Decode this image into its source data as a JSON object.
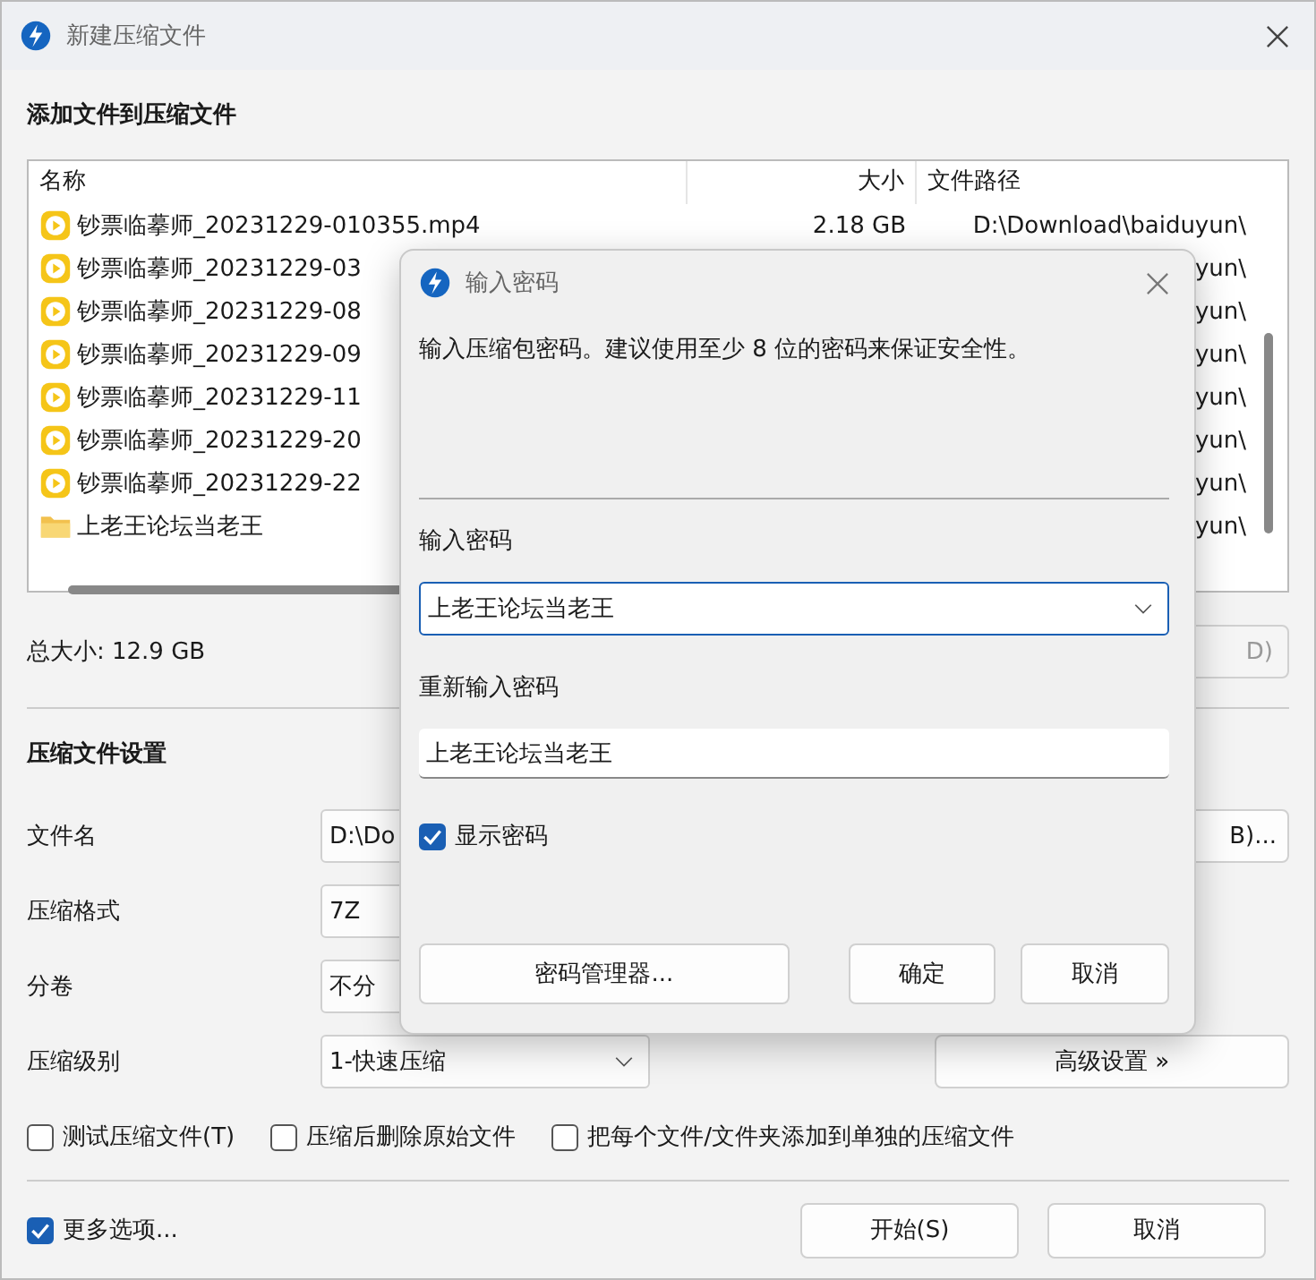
{
  "window": {
    "title": "新建压缩文件"
  },
  "files": {
    "heading": "添加文件到压缩文件",
    "columns": [
      "名称",
      "大小",
      "文件路径"
    ],
    "rows": [
      {
        "kind": "video",
        "name": "钞票临摹师_20231229-010355.mp4",
        "size": "2.18 GB",
        "path": "D:\\Download\\baiduyun\\"
      },
      {
        "kind": "video",
        "name": "钞票临摹师_20231229-03",
        "path": "yun\\"
      },
      {
        "kind": "video",
        "name": "钞票临摹师_20231229-08",
        "path": "yun\\"
      },
      {
        "kind": "video",
        "name": "钞票临摹师_20231229-09",
        "path": "yun\\"
      },
      {
        "kind": "video",
        "name": "钞票临摹师_20231229-11",
        "path": "yun\\"
      },
      {
        "kind": "video",
        "name": "钞票临摹师_20231229-20",
        "path": "yun\\"
      },
      {
        "kind": "video",
        "name": "钞票临摹师_20231229-22",
        "path": "yun\\"
      },
      {
        "kind": "folder",
        "name": "上老王论坛当老王",
        "path": "yun\\"
      }
    ]
  },
  "total_size": "总大小: 12.9 GB",
  "total_button": "D)",
  "settings": {
    "heading": "压缩文件设置",
    "rows": [
      {
        "label": "文件名",
        "kind": "field",
        "value": "D:\\Do",
        "button": "B)..."
      },
      {
        "label": "压缩格式",
        "kind": "field",
        "value": "7Z"
      },
      {
        "label": "分卷",
        "kind": "field",
        "value": "不分"
      },
      {
        "label": "压缩级别",
        "kind": "select",
        "value": "1-快速压缩",
        "button": "高级设置 »"
      }
    ]
  },
  "options": [
    {
      "label": "测试压缩文件(T)",
      "checked": false
    },
    {
      "label": "压缩后删除原始文件",
      "checked": false
    },
    {
      "label": "把每个文件/文件夹添加到单独的压缩文件",
      "checked": false
    }
  ],
  "more_options": {
    "label": "更多选项...",
    "checked": true
  },
  "buttons": [
    "开始(S)",
    "取消"
  ],
  "dialog": {
    "title": "输入密码",
    "message": "输入压缩包密码。建议使用至少 8 位的密码来保证安全性。",
    "password_label": "输入密码",
    "password": "上老王论坛当老王",
    "confirm_label": "重新输入密码",
    "confirm": "上老王论坛当老王",
    "show_password": {
      "label": "显示密码",
      "checked": true
    },
    "buttons": [
      "密码管理器...",
      "确定",
      "取消"
    ]
  }
}
